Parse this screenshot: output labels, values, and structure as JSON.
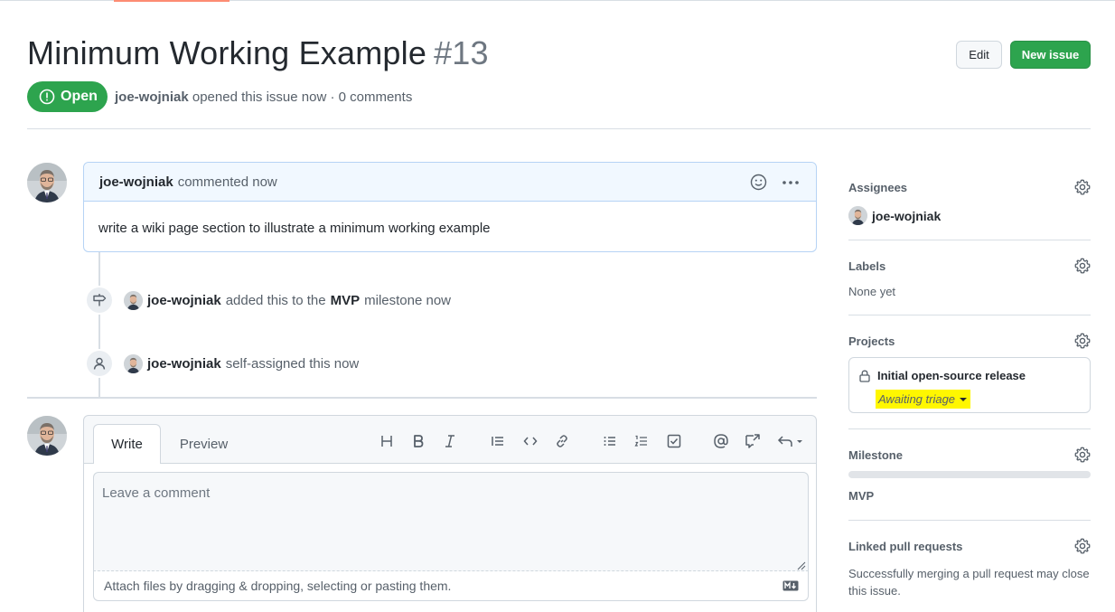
{
  "issue": {
    "title": "Minimum Working Example",
    "number": "#13",
    "state": "Open",
    "author": "joe-wojniak",
    "meta_rest": "opened this issue now · 0 comments"
  },
  "header_buttons": {
    "edit": "Edit",
    "new_issue": "New issue"
  },
  "comment": {
    "author": "joe-wojniak",
    "time": "commented now",
    "body": "write a wiki page section to illustrate a minimum working example"
  },
  "timeline": [
    {
      "actor": "joe-wojniak",
      "pre": "added this to the",
      "milestone": "MVP",
      "post": "milestone now",
      "icon": "milestone-icon"
    },
    {
      "actor": "joe-wojniak",
      "text": "self-assigned this now",
      "icon": "person-icon"
    }
  ],
  "editor": {
    "tab_write": "Write",
    "tab_preview": "Preview",
    "placeholder": "Leave a comment",
    "attach_text": "Attach files by dragging & dropping, selecting or pasting them.",
    "toolbar": [
      "heading-icon",
      "bold-icon",
      "italic-icon",
      "quote-icon",
      "code-icon",
      "link-icon",
      "bulleted-list-icon",
      "numbered-list-icon",
      "task-list-icon",
      "mention-icon",
      "reference-icon",
      "reply-icon"
    ]
  },
  "sidebar": {
    "assignees_title": "Assignees",
    "assignee": "joe-wojniak",
    "labels_title": "Labels",
    "labels_value": "None yet",
    "projects_title": "Projects",
    "project_name": "Initial open-source release",
    "project_status": "Awaiting triage",
    "milestone_title": "Milestone",
    "milestone_value": "MVP",
    "milestone_progress": 0,
    "linked_title": "Linked pull requests",
    "linked_text": "Successfully merging a pull request may close this issue."
  },
  "colors": {
    "open_green": "#2da44e",
    "highlight": "#fff700",
    "comment_header": "#f1f8ff"
  }
}
